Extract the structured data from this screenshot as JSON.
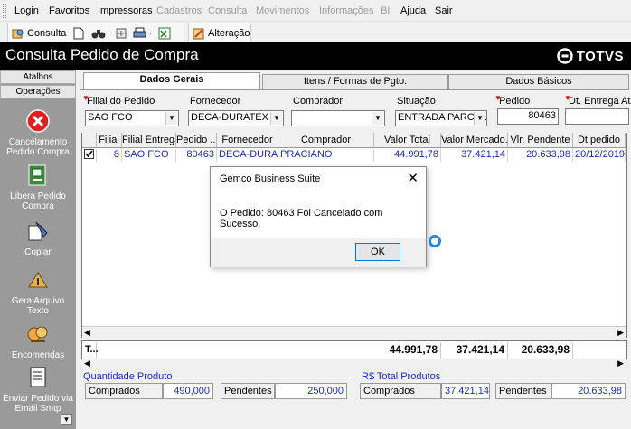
{
  "menu": {
    "items": [
      {
        "label": "Login",
        "disabled": false
      },
      {
        "label": "Favoritos",
        "disabled": false
      },
      {
        "label": "Impressoras",
        "disabled": false
      },
      {
        "label": "Cadastros",
        "disabled": true
      },
      {
        "label": "Consulta",
        "disabled": true
      },
      {
        "label": "Movimentos",
        "disabled": true
      },
      {
        "label": "Informações",
        "disabled": true
      },
      {
        "label": "BI",
        "disabled": true
      },
      {
        "label": "Ajuda",
        "disabled": false
      },
      {
        "label": "Sair",
        "disabled": false
      }
    ]
  },
  "toolbar": {
    "consulta_label": "Consulta",
    "alteracao_label": "Alteração"
  },
  "banner": {
    "title": "Consulta Pedido de Compra",
    "logo": "TOTVS"
  },
  "sidebar": {
    "tabs": [
      "Atalhos",
      "Operações"
    ],
    "tools": [
      {
        "label": "Cancelamento Pedido Compra",
        "icon": "cancel-icon"
      },
      {
        "label": "Libera Pedido Compra",
        "icon": "release-icon"
      },
      {
        "label": "Copiar",
        "icon": "copy-icon"
      },
      {
        "label": "Gera Arquivo Texto",
        "icon": "text-file-icon"
      },
      {
        "label": "Encomendas",
        "icon": "orders-icon"
      },
      {
        "label": "Enviar Pedido via Email Smtp",
        "icon": "email-icon"
      }
    ]
  },
  "tabs": [
    "Dados Gerais",
    "Itens / Formas de Pgto.",
    "Dados Básicos"
  ],
  "filters": {
    "filial": {
      "label": "Filial do Pedido",
      "value": "SAO FCO"
    },
    "fornecedor": {
      "label": "Fornecedor",
      "value": "DECA-DURATEX"
    },
    "comprador": {
      "label": "Comprador",
      "value": ""
    },
    "situacao": {
      "label": "Situação",
      "value": "ENTRADA PARCIAL"
    },
    "pedido": {
      "label": "Pedido",
      "value": "80463"
    },
    "dt_entrega": {
      "label": "Dt. Entrega Até",
      "value": ""
    }
  },
  "grid": {
    "headers": [
      "Filial",
      "Filial Entrega",
      "Pedido ...",
      "Fornecedor",
      "Comprador",
      "Valor Total",
      "Valor Mercado...",
      "Vlr. Pendente",
      "Dt.pedido"
    ],
    "rows": [
      {
        "checked": true,
        "cells": [
          "8",
          "SAO FCO",
          "80463",
          "DECA-DURA...",
          "PRACIANO",
          "44.991,78",
          "37.421,14",
          "20.633,98",
          "20/12/2019"
        ]
      }
    ],
    "footer": {
      "label": "T...",
      "valor_total": "44.991,78",
      "valor_mercadoria": "37.421,14",
      "vlr_pendente": "20.633,98"
    }
  },
  "quantidade": {
    "title": "Quantidade Produto",
    "comprados_label": "Comprados",
    "comprados_value": "490,000",
    "pendentes_label": "Pendentes",
    "pendentes_value": "250,000"
  },
  "total_produtos": {
    "title": "R$ Total Produtos",
    "comprados_label": "Comprados",
    "comprados_value": "37.421,14",
    "pendentes_label": "Pendentes",
    "pendentes_value": "20.633,98"
  },
  "dialog": {
    "title": "Gemco Business Suite",
    "message": "O Pedido: 80463 Foi Cancelado com Sucesso.",
    "ok_label": "OK"
  },
  "colors": {
    "banner_bg": "#000000",
    "sidebar_bg": "#9a9a9a",
    "accent_blue": "#1a2db0",
    "selection_blue": "#0078d7"
  }
}
